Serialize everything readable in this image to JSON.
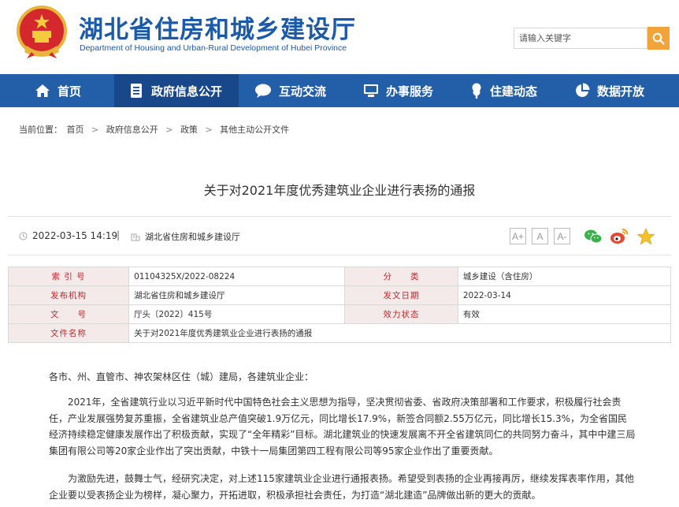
{
  "header": {
    "site_title": "湖北省住房和城乡建设厅",
    "site_subtitle": "Department of Housing and Urban-Rural Development of Hubei Province",
    "search_placeholder": "请输入关键字",
    "emblem_icon": "national-emblem-icon",
    "search_icon": "search-icon"
  },
  "nav": {
    "items": [
      {
        "label": "首页",
        "icon": "home-icon"
      },
      {
        "label": "政府信息公开",
        "icon": "document-icon",
        "active": true
      },
      {
        "label": "互动交流",
        "icon": "chat-bubble-icon"
      },
      {
        "label": "办事服务",
        "icon": "monitor-icon"
      },
      {
        "label": "住建动态",
        "icon": "tree-icon"
      },
      {
        "label": "数据开放",
        "icon": "pie-chart-icon"
      }
    ]
  },
  "breadcrumb": {
    "prefix": "当前位置：",
    "items": [
      "首页",
      "政府信息公开",
      "政策",
      "其他主动公开文件"
    ],
    "separator": ">"
  },
  "article": {
    "title": "关于对2021年度优秀建筑业企业进行表扬的通报",
    "date": "2022-03-15 14:19",
    "divider": "|",
    "source": "湖北省住房和城乡建设厅",
    "font_buttons": [
      "A+",
      "A",
      "A-"
    ],
    "share_icons": [
      "wechat-icon",
      "weibo-icon",
      "favorite-star-icon"
    ]
  },
  "info_table": {
    "rows": [
      {
        "k1": "索 引 号",
        "v1": "01104325X/2022-08224",
        "k2": "分　　类",
        "v2": "城乡建设（含住房）"
      },
      {
        "k1": "发布机构",
        "v1": "湖北省住房和城乡建设厅",
        "k2": "发文日期",
        "v2": "2022-03-14"
      },
      {
        "k1": "文　　号",
        "v1": "厅头〔2022〕415号",
        "k2": "效力状态",
        "v2": "有效"
      },
      {
        "k1": "文件名称",
        "v1": "关于对2021年度优秀建筑业企业进行表扬的通报"
      }
    ]
  },
  "body": {
    "p0": "各市、州、直管市、神农架林区住（城）建局，各建筑业企业：",
    "p1": "2021年，全省建筑行业以习近平新时代中国特色社会主义思想为指导，坚决贯彻省委、省政府决策部署和工作要求，积极履行社会责任，产业发展强势复苏重振，全省建筑业总产值突破1.9万亿元，同比增长17.9%，新签合同额2.55万亿元，同比增长15.3%，为全省国民经济持续稳定健康发展作出了积极贡献，实现了“全年精彩”目标。湖北建筑业的快速发展离不开全省建筑同仁的共同努力奋斗，其中中建三局集团有限公司等20家企业作出了突出贡献，中铁十一局集团第四工程有限公司等95家企业作出了重要贡献。",
    "p2": "为激励先进，鼓舞士气，经研究决定，对上述115家建筑业企业进行通报表扬。希望受到表扬的企业再接再厉，继续发挥表率作用，其他企业要以受表扬企业为榜样，凝心聚力，开拓进取，积极承担社会责任，为打造“湖北建造”品牌做出新的更大的贡献。"
  },
  "colors": {
    "brand_blue": "#1b5aa8",
    "nav_blue": "#235ea9",
    "nav_active": "#18488a",
    "search_orange": "#f2a33a",
    "table_key_bg": "#f4eaea",
    "table_key_text": "#c0282d"
  }
}
